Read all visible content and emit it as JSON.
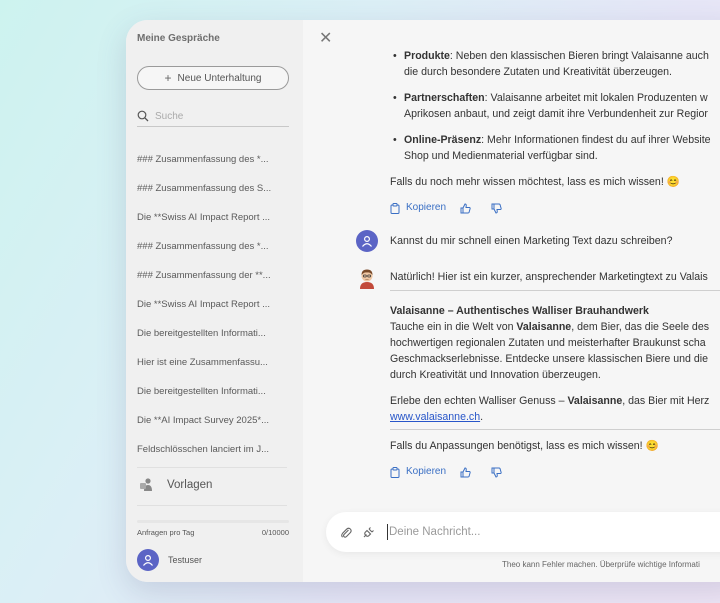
{
  "sidebar": {
    "title": "Meine Gespräche",
    "new_button": "Neue Unterhaltung",
    "search_placeholder": "Suche",
    "conversations": [
      "### Zusammenfassung des *...",
      "### Zusammenfassung des S...",
      "Die **Swiss AI Impact Report ...",
      "### Zusammenfassung des *...",
      "### Zusammenfassung der **...",
      "Die **Swiss AI Impact Report ...",
      "Die bereitgestellten Informati...",
      "Hier ist eine Zusammenfassu...",
      "Die bereitgestellten Informati...",
      "Die **AI Impact Survey 2025*...",
      "Feldschlösschen lanciert im J..."
    ],
    "templates_label": "Vorlagen",
    "usage_label": "Anfragen pro Tag",
    "usage_count": "0/10000",
    "usage_fraction": 0,
    "user_name": "Testuser"
  },
  "chat": {
    "bullets": [
      {
        "bold": "Produkte",
        "text": ": Neben den klassischen Bieren bringt Valaisanne auch",
        "cont": "die durch besondere Zutaten und Kreativität überzeugen."
      },
      {
        "bold": "Partnerschaften",
        "text": ": Valaisanne arbeitet mit lokalen Produzenten w",
        "cont": "Aprikosen anbaut, und zeigt damit ihre Verbundenheit zur Regior"
      },
      {
        "bold": "Online-Präsenz",
        "text": ": Mehr Informationen findest du auf ihrer Website",
        "cont": "Shop und Medienmaterial verfügbar sind."
      }
    ],
    "closing_1": "Falls du noch mehr wissen möchtest, lass es mich wissen! 😊",
    "copy_label": "Kopieren",
    "user_message": "Kannst du mir schnell einen Marketing Text dazu schreiben?",
    "bot_intro": "Natürlich! Hier ist ein kurzer, ansprechender Marketingtext zu Valais",
    "headline": "Valaisanne – Authentisches Walliser Brauhandwerk",
    "body_l1_pre": "Tauche ein in die Welt von ",
    "body_l1_bold": "Valaisanne",
    "body_l1_post": ", dem Bier, das die Seele des",
    "body_l2": "hochwertigen regionalen Zutaten und meisterhafter Braukunst scha",
    "body_l3": "Geschmackserlebnisse. Entdecke unsere klassischen Biere und die",
    "body_l4": "durch Kreativität und Innovation überzeugen.",
    "cta_pre": "Erlebe den echten Walliser Genuss – ",
    "cta_bold": "Valaisanne",
    "cta_post": ", das Bier mit Herz",
    "link": "www.valaisanne.ch",
    "link_suffix": ".",
    "closing_2": "Falls du Anpassungen benötigst, lass es mich wissen! 😊"
  },
  "input": {
    "placeholder": "Deine Nachricht..."
  },
  "disclaimer": "Theo kann Fehler machen. Überprüfe wichtige Informati",
  "colors": {
    "accent": "#5b64c5",
    "link": "#2856c9",
    "action": "#3a6fc4"
  }
}
